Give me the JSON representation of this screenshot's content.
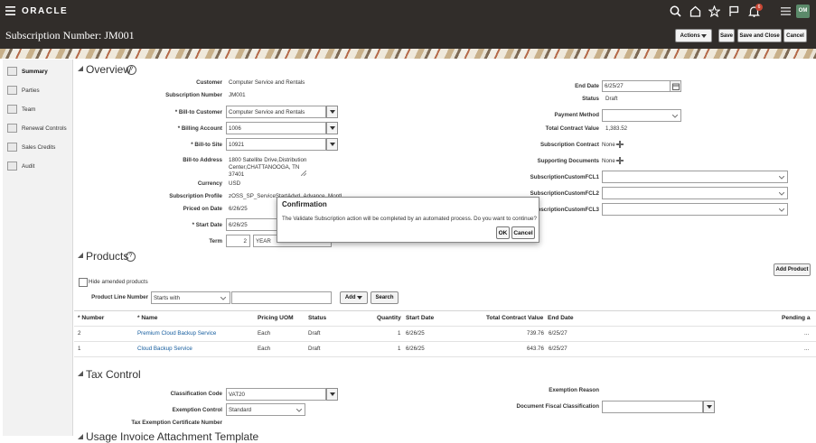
{
  "header": {
    "brand": "ORACLE",
    "notification_count": "6",
    "avatar_initials": "OM",
    "page_title": "Subscription Number: JM001",
    "actions_label": "Actions",
    "save_label": "Save",
    "save_close_label": "Save and Close",
    "cancel_label": "Cancel"
  },
  "sidebar": {
    "items": [
      {
        "label": "Summary"
      },
      {
        "label": "Parties"
      },
      {
        "label": "Team"
      },
      {
        "label": "Renewal Controls"
      },
      {
        "label": "Sales Credits"
      },
      {
        "label": "Audit"
      }
    ]
  },
  "overview": {
    "title": "Overview",
    "customer_label": "Customer",
    "customer_value": "Computer Service and Rentals",
    "subscription_number_label": "Subscription Number",
    "subscription_number_value": "JM001",
    "bill_to_customer_label": "Bill-to Customer",
    "bill_to_customer_value": "Computer Service and Rentals",
    "billing_account_label": "Billing Account",
    "billing_account_value": "1006",
    "bill_to_site_label": "Bill-to Site",
    "bill_to_site_value": "10921",
    "bill_to_address_label": "Bill-to Address",
    "bill_to_address_line1": "1800 Satellite Drive,Distribution",
    "bill_to_address_line2": "Center,CHATTANOOGA, TN",
    "bill_to_address_line3": "37401",
    "currency_label": "Currency",
    "currency_value": "USD",
    "subscription_profile_label": "Subscription Profile",
    "subscription_profile_value": "zOSS_SP_ServiceStartAdvd_Advance_Month",
    "priced_on_date_label": "Priced on Date",
    "priced_on_date_value": "6/26/25",
    "start_date_label": "Start Date",
    "start_date_value": "6/26/25",
    "term_label": "Term",
    "term_value": "2",
    "term_unit": "YEAR",
    "end_date_label": "End Date",
    "end_date_value": "6/25/27",
    "status_label": "Status",
    "status_value": "Draft",
    "payment_method_label": "Payment Method",
    "total_contract_value_label": "Total Contract Value",
    "total_contract_value": "1,383.52",
    "subscription_contract_label": "Subscription Contract",
    "subscription_contract_value": "None",
    "supporting_documents_label": "Supporting Documents",
    "supporting_documents_value": "None",
    "custom_fcl1_label": "SubscriptionCustomFCL1",
    "custom_fcl2_label": "SubscriptionCustomFCL2",
    "custom_fcl3_label": "SubscriptionCustomFCL3"
  },
  "dialog": {
    "title": "Confirmation",
    "message": "The Validate Subscription action will be completed by an automated process. Do you want to continue?",
    "ok_label": "OK",
    "cancel_label": "Cancel"
  },
  "products": {
    "title": "Products",
    "add_product_label": "Add Product",
    "hide_amended_label": "Hide amended products",
    "product_line_number_label": "Product Line Number",
    "operator_value": "Starts with",
    "add_label": "Add",
    "search_label": "Search",
    "columns": [
      "Number",
      "Name",
      "Pricing UOM",
      "Status",
      "Quantity",
      "Start Date",
      "Total Contract Value",
      "End Date",
      "Pending a"
    ],
    "rows": [
      {
        "number": "2",
        "name": "Premium Cloud Backup Service",
        "uom": "Each",
        "status": "Draft",
        "quantity": "1",
        "start": "6/26/25",
        "total": "739.76",
        "end": "6/25/27",
        "pending": "..."
      },
      {
        "number": "1",
        "name": "Cloud Backup Service",
        "uom": "Each",
        "status": "Draft",
        "quantity": "1",
        "start": "6/26/25",
        "total": "643.76",
        "end": "6/25/27",
        "pending": "..."
      }
    ]
  },
  "tax": {
    "title": "Tax Control",
    "classification_code_label": "Classification Code",
    "classification_code_value": "VAT20",
    "exemption_control_label": "Exemption Control",
    "exemption_control_value": "Standard",
    "tax_exemption_cert_label": "Tax Exemption Certificate Number",
    "exemption_reason_label": "Exemption Reason",
    "doc_fiscal_class_label": "Document Fiscal Classification"
  },
  "usage": {
    "title": "Usage Invoice Attachment Template"
  },
  "colors": {
    "header_bg": "#312d2a",
    "link": "#145c9e",
    "badge": "#c74634",
    "avatar_bg": "#5b8a6a"
  }
}
